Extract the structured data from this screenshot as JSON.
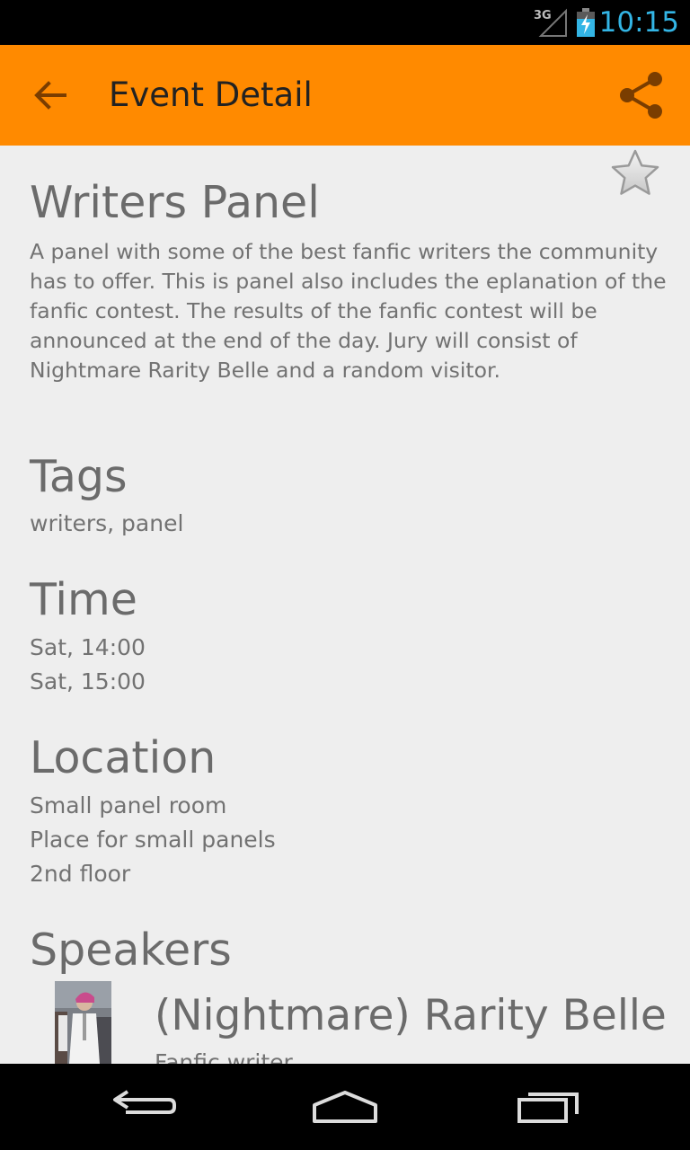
{
  "status_bar": {
    "network_label": "3G",
    "time": "10:15",
    "clock_color": "#33b5e5"
  },
  "action_bar": {
    "title": "Event Detail",
    "background_color": "#ff8a00",
    "back_icon": "arrow-left-icon",
    "share_icon": "share-icon"
  },
  "event": {
    "favorite_icon": "star-outline-icon",
    "title": "Writers Panel",
    "description": "A panel with some of the best fanfic writers the community has to offer. This is panel also includes the eplanation of the fanfic contest. The results of the fanfic contest will be announced at the end of the day. Jury will consist of Nightmare Rarity Belle and a random visitor."
  },
  "sections": {
    "tags": {
      "heading": "Tags",
      "value": "writers, panel"
    },
    "time": {
      "heading": "Time",
      "start": "Sat, 14:00",
      "end": "Sat, 15:00"
    },
    "location": {
      "heading": "Location",
      "name": "Small panel room",
      "description": "Place for small panels",
      "floor": "2nd floor"
    },
    "speakers": {
      "heading": "Speakers",
      "items": [
        {
          "name": "(Nightmare) Rarity Belle",
          "role": "Fanfic writer"
        }
      ]
    }
  },
  "nav_bar": {
    "back_icon": "nav-back-icon",
    "home_icon": "nav-home-icon",
    "recents_icon": "nav-recents-icon"
  }
}
